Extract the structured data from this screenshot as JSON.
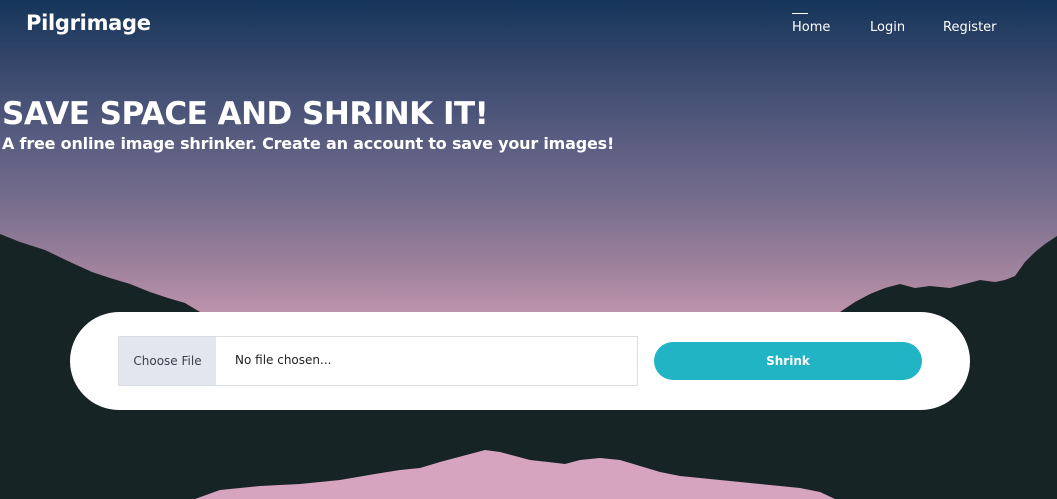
{
  "nav": {
    "brand": "Pilgrimage",
    "links": [
      "Home",
      "Login",
      "Register"
    ],
    "active": "Home"
  },
  "hero": {
    "title": "SAVE SPACE AND SHRINK IT!",
    "subtitle": "A free online image shrinker. Create an account to save your images!"
  },
  "upload": {
    "choose_label": "Choose File",
    "file_status": "No file chosen...",
    "submit_label": "Shrink"
  },
  "colors": {
    "accent": "#20b4c4",
    "mountains": "#172426",
    "sky_top": "#15355a",
    "sky_bottom": "#d7a4bf"
  }
}
